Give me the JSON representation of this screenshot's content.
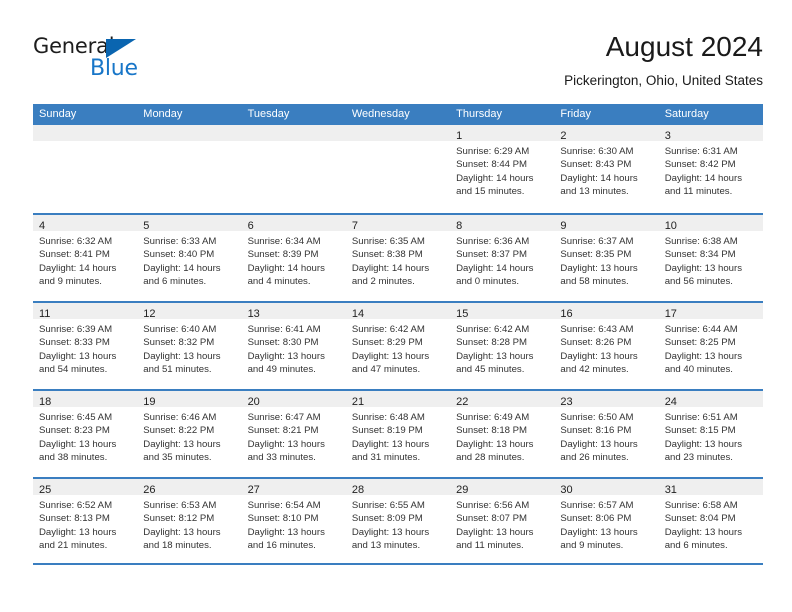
{
  "brand": {
    "name_top": "General",
    "name_bottom": "Blue",
    "triangle_color": "#0a65b0",
    "blue_color": "#1876c8"
  },
  "header": {
    "title": "August 2024",
    "subtitle": "Pickerington, Ohio, United States"
  },
  "theme": {
    "header_bar": "#3a7ec0",
    "daynum_band": "#efefef",
    "text": "#333333"
  },
  "weekdays": [
    "Sunday",
    "Monday",
    "Tuesday",
    "Wednesday",
    "Thursday",
    "Friday",
    "Saturday"
  ],
  "weeks": [
    [
      {
        "day": "",
        "lines": []
      },
      {
        "day": "",
        "lines": []
      },
      {
        "day": "",
        "lines": []
      },
      {
        "day": "",
        "lines": []
      },
      {
        "day": "1",
        "lines": [
          "Sunrise: 6:29 AM",
          "Sunset: 8:44 PM",
          "Daylight: 14 hours and 15 minutes."
        ]
      },
      {
        "day": "2",
        "lines": [
          "Sunrise: 6:30 AM",
          "Sunset: 8:43 PM",
          "Daylight: 14 hours and 13 minutes."
        ]
      },
      {
        "day": "3",
        "lines": [
          "Sunrise: 6:31 AM",
          "Sunset: 8:42 PM",
          "Daylight: 14 hours and 11 minutes."
        ]
      }
    ],
    [
      {
        "day": "4",
        "lines": [
          "Sunrise: 6:32 AM",
          "Sunset: 8:41 PM",
          "Daylight: 14 hours and 9 minutes."
        ]
      },
      {
        "day": "5",
        "lines": [
          "Sunrise: 6:33 AM",
          "Sunset: 8:40 PM",
          "Daylight: 14 hours and 6 minutes."
        ]
      },
      {
        "day": "6",
        "lines": [
          "Sunrise: 6:34 AM",
          "Sunset: 8:39 PM",
          "Daylight: 14 hours and 4 minutes."
        ]
      },
      {
        "day": "7",
        "lines": [
          "Sunrise: 6:35 AM",
          "Sunset: 8:38 PM",
          "Daylight: 14 hours and 2 minutes."
        ]
      },
      {
        "day": "8",
        "lines": [
          "Sunrise: 6:36 AM",
          "Sunset: 8:37 PM",
          "Daylight: 14 hours and 0 minutes."
        ]
      },
      {
        "day": "9",
        "lines": [
          "Sunrise: 6:37 AM",
          "Sunset: 8:35 PM",
          "Daylight: 13 hours and 58 minutes."
        ]
      },
      {
        "day": "10",
        "lines": [
          "Sunrise: 6:38 AM",
          "Sunset: 8:34 PM",
          "Daylight: 13 hours and 56 minutes."
        ]
      }
    ],
    [
      {
        "day": "11",
        "lines": [
          "Sunrise: 6:39 AM",
          "Sunset: 8:33 PM",
          "Daylight: 13 hours and 54 minutes."
        ]
      },
      {
        "day": "12",
        "lines": [
          "Sunrise: 6:40 AM",
          "Sunset: 8:32 PM",
          "Daylight: 13 hours and 51 minutes."
        ]
      },
      {
        "day": "13",
        "lines": [
          "Sunrise: 6:41 AM",
          "Sunset: 8:30 PM",
          "Daylight: 13 hours and 49 minutes."
        ]
      },
      {
        "day": "14",
        "lines": [
          "Sunrise: 6:42 AM",
          "Sunset: 8:29 PM",
          "Daylight: 13 hours and 47 minutes."
        ]
      },
      {
        "day": "15",
        "lines": [
          "Sunrise: 6:42 AM",
          "Sunset: 8:28 PM",
          "Daylight: 13 hours and 45 minutes."
        ]
      },
      {
        "day": "16",
        "lines": [
          "Sunrise: 6:43 AM",
          "Sunset: 8:26 PM",
          "Daylight: 13 hours and 42 minutes."
        ]
      },
      {
        "day": "17",
        "lines": [
          "Sunrise: 6:44 AM",
          "Sunset: 8:25 PM",
          "Daylight: 13 hours and 40 minutes."
        ]
      }
    ],
    [
      {
        "day": "18",
        "lines": [
          "Sunrise: 6:45 AM",
          "Sunset: 8:23 PM",
          "Daylight: 13 hours and 38 minutes."
        ]
      },
      {
        "day": "19",
        "lines": [
          "Sunrise: 6:46 AM",
          "Sunset: 8:22 PM",
          "Daylight: 13 hours and 35 minutes."
        ]
      },
      {
        "day": "20",
        "lines": [
          "Sunrise: 6:47 AM",
          "Sunset: 8:21 PM",
          "Daylight: 13 hours and 33 minutes."
        ]
      },
      {
        "day": "21",
        "lines": [
          "Sunrise: 6:48 AM",
          "Sunset: 8:19 PM",
          "Daylight: 13 hours and 31 minutes."
        ]
      },
      {
        "day": "22",
        "lines": [
          "Sunrise: 6:49 AM",
          "Sunset: 8:18 PM",
          "Daylight: 13 hours and 28 minutes."
        ]
      },
      {
        "day": "23",
        "lines": [
          "Sunrise: 6:50 AM",
          "Sunset: 8:16 PM",
          "Daylight: 13 hours and 26 minutes."
        ]
      },
      {
        "day": "24",
        "lines": [
          "Sunrise: 6:51 AM",
          "Sunset: 8:15 PM",
          "Daylight: 13 hours and 23 minutes."
        ]
      }
    ],
    [
      {
        "day": "25",
        "lines": [
          "Sunrise: 6:52 AM",
          "Sunset: 8:13 PM",
          "Daylight: 13 hours and 21 minutes."
        ]
      },
      {
        "day": "26",
        "lines": [
          "Sunrise: 6:53 AM",
          "Sunset: 8:12 PM",
          "Daylight: 13 hours and 18 minutes."
        ]
      },
      {
        "day": "27",
        "lines": [
          "Sunrise: 6:54 AM",
          "Sunset: 8:10 PM",
          "Daylight: 13 hours and 16 minutes."
        ]
      },
      {
        "day": "28",
        "lines": [
          "Sunrise: 6:55 AM",
          "Sunset: 8:09 PM",
          "Daylight: 13 hours and 13 minutes."
        ]
      },
      {
        "day": "29",
        "lines": [
          "Sunrise: 6:56 AM",
          "Sunset: 8:07 PM",
          "Daylight: 13 hours and 11 minutes."
        ]
      },
      {
        "day": "30",
        "lines": [
          "Sunrise: 6:57 AM",
          "Sunset: 8:06 PM",
          "Daylight: 13 hours and 9 minutes."
        ]
      },
      {
        "day": "31",
        "lines": [
          "Sunrise: 6:58 AM",
          "Sunset: 8:04 PM",
          "Daylight: 13 hours and 6 minutes."
        ]
      }
    ]
  ]
}
